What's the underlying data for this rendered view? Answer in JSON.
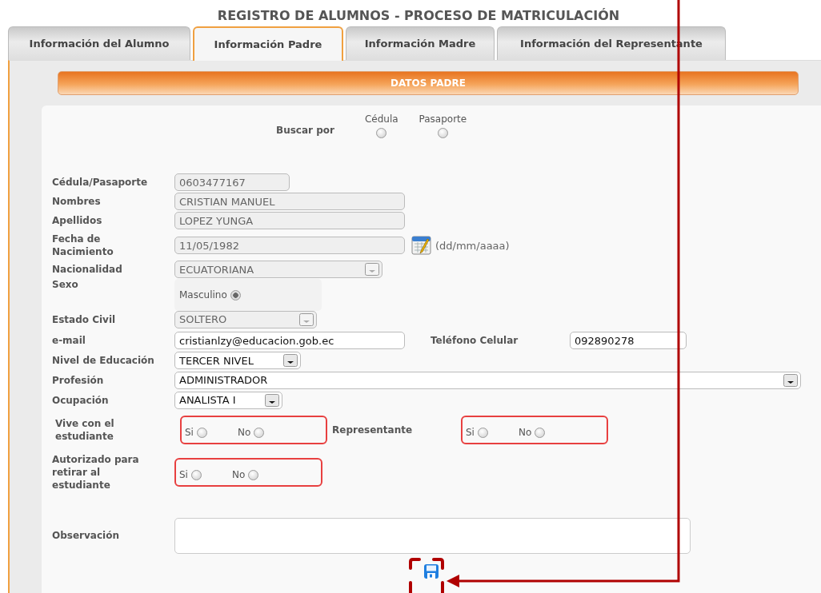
{
  "title": "REGISTRO DE ALUMNOS - PROCESO DE MATRICULACIÓN",
  "tabs": [
    {
      "label": "Información del Alumno",
      "selected": false
    },
    {
      "label": "Información Padre",
      "selected": true
    },
    {
      "label": "Información Madre",
      "selected": false
    },
    {
      "label": "Información del Representante",
      "selected": false
    }
  ],
  "section_header": "DATOS PADRE",
  "search": {
    "label": "Buscar por",
    "options": [
      {
        "label": "Cédula",
        "selected": false
      },
      {
        "label": "Pasaporte",
        "selected": false
      }
    ]
  },
  "cedula": {
    "label": "Cédula/Pasaporte",
    "value": "0603477167",
    "disabled": true
  },
  "nombres": {
    "label": "Nombres",
    "value": "CRISTIAN MANUEL",
    "disabled": true
  },
  "apellidos": {
    "label": "Apellidos",
    "value": "LOPEZ YUNGA",
    "disabled": true
  },
  "fecha": {
    "label": "Fecha de Nacimiento",
    "value": "11/05/1982",
    "disabled": true,
    "hint": "(dd/mm/aaaa)"
  },
  "nacionalidad": {
    "label": "Nacionalidad",
    "value": "ECUATORIANA",
    "disabled": true
  },
  "sexo": {
    "label": "Sexo",
    "option": "Masculino",
    "selected": true
  },
  "estado_civil": {
    "label": "Estado Civil",
    "value": "SOLTERO",
    "disabled": true
  },
  "email": {
    "label": "e-mail",
    "value": "cristianlzy@educacion.gob.ec",
    "disabled": false
  },
  "telefono": {
    "label": "Teléfono Celular",
    "value": "092890278",
    "disabled": false
  },
  "nivel_educacion": {
    "label": "Nivel de Educación",
    "value": "TERCER NIVEL",
    "disabled": false
  },
  "profesion": {
    "label": "Profesión",
    "value": "ADMINISTRADOR",
    "disabled": false
  },
  "ocupacion": {
    "label": "Ocupación",
    "value": "ANALISTA I",
    "disabled": false
  },
  "vive_con_estudiante": {
    "label": "Vive con el estudiante",
    "options": [
      {
        "label": "Si",
        "selected": false
      },
      {
        "label": "No",
        "selected": false
      }
    ]
  },
  "representante": {
    "label": "Representante",
    "options": [
      {
        "label": "Si",
        "selected": false
      },
      {
        "label": "No",
        "selected": false
      }
    ]
  },
  "autorizado": {
    "label": "Autorizado para retirar al estudiante",
    "options": [
      {
        "label": "Si",
        "selected": false
      },
      {
        "label": "No",
        "selected": false
      }
    ]
  },
  "observacion": {
    "label": "Observación"
  }
}
